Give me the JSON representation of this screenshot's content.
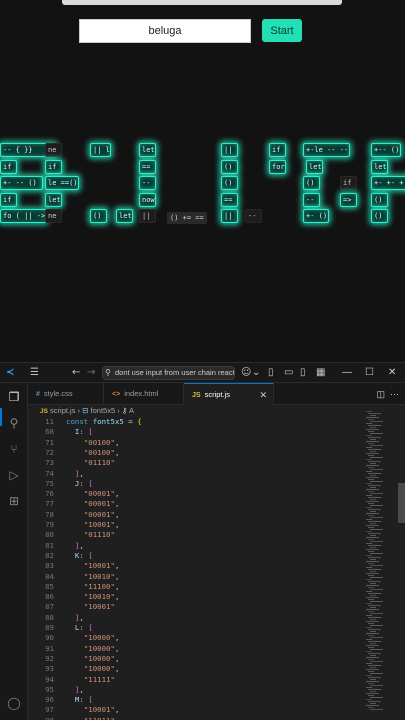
{
  "preview": {
    "input_value": "beluga",
    "start_label": "Start",
    "tiles": [
      {
        "text": "-- {  }}",
        "on": true,
        "row": 0,
        "col": 0,
        "w": 12
      },
      {
        "text": "ne",
        "on": false,
        "row": 0,
        "col": 0.66,
        "w": 3
      },
      {
        "text": "|| le",
        "on": true,
        "row": 0,
        "col": 1.33,
        "w": 4
      },
      {
        "text": "let",
        "on": true,
        "row": 0,
        "col": 2.05,
        "w": 3
      },
      {
        "text": "||",
        "on": true,
        "row": 0,
        "col": 3.25,
        "w": 3
      },
      {
        "text": "if",
        "on": true,
        "row": 0,
        "col": 3.95,
        "w": 3
      },
      {
        "text": "+-le -- --",
        "on": true,
        "row": 0,
        "col": 4.46,
        "w": 10
      },
      {
        "text": "+-- ()",
        "on": true,
        "row": 0,
        "col": 5.45,
        "w": 6
      },
      {
        "text": "if",
        "on": true,
        "row": 1,
        "col": 0,
        "w": 3
      },
      {
        "text": "if",
        "on": true,
        "row": 1,
        "col": 0.66,
        "w": 3
      },
      {
        "text": "==",
        "on": true,
        "row": 1,
        "col": 2.05,
        "w": 3
      },
      {
        "text": "()",
        "on": true,
        "row": 1,
        "col": 3.25,
        "w": 3
      },
      {
        "text": "for",
        "on": true,
        "row": 1,
        "col": 3.95,
        "w": 3
      },
      {
        "text": "let",
        "on": true,
        "row": 1,
        "col": 4.5,
        "w": 3
      },
      {
        "text": "let",
        "on": true,
        "row": 1,
        "col": 5.45,
        "w": 3
      },
      {
        "text": "+-  -- ()",
        "on": true,
        "row": 2,
        "col": 0,
        "w": 9
      },
      {
        "text": "le ==()",
        "on": true,
        "row": 2,
        "col": 0.66,
        "w": 7
      },
      {
        "text": "--",
        "on": true,
        "row": 2,
        "col": 2.05,
        "w": 3
      },
      {
        "text": "()",
        "on": true,
        "row": 2,
        "col": 3.25,
        "w": 3
      },
      {
        "text": "()",
        "on": true,
        "row": 2,
        "col": 4.46,
        "w": 3
      },
      {
        "text": "if",
        "on": false,
        "row": 2,
        "col": 5.0,
        "w": 3
      },
      {
        "text": "+- +- + ()",
        "on": true,
        "row": 2,
        "col": 5.45,
        "w": 10
      },
      {
        "text": "if",
        "on": true,
        "row": 3,
        "col": 0,
        "w": 3
      },
      {
        "text": "let",
        "on": true,
        "row": 3,
        "col": 0.66,
        "w": 3
      },
      {
        "text": "now",
        "on": true,
        "row": 3,
        "col": 2.05,
        "w": 3
      },
      {
        "text": "==",
        "on": true,
        "row": 3,
        "col": 3.25,
        "w": 3
      },
      {
        "text": "--",
        "on": true,
        "row": 3,
        "col": 4.46,
        "w": 3
      },
      {
        "text": "=>",
        "on": true,
        "row": 3,
        "col": 5.0,
        "w": 3
      },
      {
        "text": "()",
        "on": true,
        "row": 3,
        "col": 5.45,
        "w": 3
      },
      {
        "text": "fo ( || ->",
        "on": true,
        "row": 4,
        "col": 0,
        "w": 10
      },
      {
        "text": "ne",
        "on": false,
        "row": 4,
        "col": 0.66,
        "w": 3
      },
      {
        "text": "()",
        "on": true,
        "row": 4,
        "col": 1.33,
        "w": 3
      },
      {
        "text": "let",
        "on": true,
        "row": 4,
        "col": 1.7,
        "w": 3
      },
      {
        "text": "||",
        "on": false,
        "row": 4,
        "col": 2.05,
        "w": 3
      },
      {
        "text": "||",
        "on": true,
        "row": 4,
        "col": 3.25,
        "w": 3
      },
      {
        "text": "--",
        "on": false,
        "row": 4,
        "col": 3.6,
        "w": 3
      },
      {
        "text": "+- ()",
        "on": true,
        "row": 4,
        "col": 4.46,
        "w": 5
      },
      {
        "text": "()",
        "on": true,
        "row": 4,
        "col": 5.45,
        "w": 3
      }
    ],
    "floating_token": "() += =="
  },
  "vscode": {
    "command_center": "dont use input from user chain reactio",
    "tabs": [
      {
        "icon": "#",
        "label": "style.css",
        "active": false
      },
      {
        "icon": "<>",
        "label": "index.html",
        "active": false
      },
      {
        "icon": "JS",
        "label": "script.js",
        "active": true
      }
    ],
    "breadcrumb": [
      "script.js",
      "font5x5",
      "A"
    ],
    "sticky": [
      {
        "n": "11",
        "parts": [
          [
            "kw",
            "const "
          ],
          [
            "var",
            "font5x5"
          ],
          [
            "punc",
            " = "
          ],
          [
            "br1",
            "{"
          ]
        ]
      },
      {
        "n": "68",
        "parts": [
          [
            "punc",
            "  "
          ],
          [
            "var",
            "I"
          ],
          [
            "punc",
            ": "
          ],
          [
            "br2",
            "["
          ]
        ]
      }
    ],
    "lines": [
      {
        "n": "71",
        "parts": [
          [
            "punc",
            "    "
          ],
          [
            "str",
            "\"00100\""
          ],
          [
            "punc",
            ","
          ]
        ]
      },
      {
        "n": "72",
        "parts": [
          [
            "punc",
            "    "
          ],
          [
            "str",
            "\"00100\""
          ],
          [
            "punc",
            ","
          ]
        ]
      },
      {
        "n": "73",
        "parts": [
          [
            "punc",
            "    "
          ],
          [
            "str",
            "\"01110\""
          ]
        ]
      },
      {
        "n": "74",
        "parts": [
          [
            "punc",
            "  "
          ],
          [
            "br2",
            "]"
          ],
          [
            "punc",
            ","
          ]
        ]
      },
      {
        "n": "75",
        "parts": [
          [
            "punc",
            "  "
          ],
          [
            "var",
            "J"
          ],
          [
            "punc",
            ": "
          ],
          [
            "br2",
            "["
          ]
        ]
      },
      {
        "n": "76",
        "parts": [
          [
            "punc",
            "    "
          ],
          [
            "str",
            "\"00001\""
          ],
          [
            "punc",
            ","
          ]
        ]
      },
      {
        "n": "77",
        "parts": [
          [
            "punc",
            "    "
          ],
          [
            "str",
            "\"00001\""
          ],
          [
            "punc",
            ","
          ]
        ]
      },
      {
        "n": "78",
        "parts": [
          [
            "punc",
            "    "
          ],
          [
            "str",
            "\"00001\""
          ],
          [
            "punc",
            ","
          ]
        ]
      },
      {
        "n": "79",
        "parts": [
          [
            "punc",
            "    "
          ],
          [
            "str",
            "\"10001\""
          ],
          [
            "punc",
            ","
          ]
        ]
      },
      {
        "n": "80",
        "parts": [
          [
            "punc",
            "    "
          ],
          [
            "str",
            "\"01110\""
          ]
        ]
      },
      {
        "n": "81",
        "parts": [
          [
            "punc",
            "  "
          ],
          [
            "br2",
            "]"
          ],
          [
            "punc",
            ","
          ]
        ]
      },
      {
        "n": "82",
        "parts": [
          [
            "punc",
            "  "
          ],
          [
            "var",
            "K"
          ],
          [
            "punc",
            ": "
          ],
          [
            "br2",
            "["
          ]
        ]
      },
      {
        "n": "83",
        "parts": [
          [
            "punc",
            "    "
          ],
          [
            "str",
            "\"10001\""
          ],
          [
            "punc",
            ","
          ]
        ]
      },
      {
        "n": "84",
        "parts": [
          [
            "punc",
            "    "
          ],
          [
            "str",
            "\"10010\""
          ],
          [
            "punc",
            ","
          ]
        ]
      },
      {
        "n": "85",
        "parts": [
          [
            "punc",
            "    "
          ],
          [
            "str",
            "\"11100\""
          ],
          [
            "punc",
            ","
          ]
        ]
      },
      {
        "n": "86",
        "parts": [
          [
            "punc",
            "    "
          ],
          [
            "str",
            "\"10010\""
          ],
          [
            "punc",
            ","
          ]
        ]
      },
      {
        "n": "87",
        "parts": [
          [
            "punc",
            "    "
          ],
          [
            "str",
            "\"10001\""
          ]
        ]
      },
      {
        "n": "88",
        "parts": [
          [
            "punc",
            "  "
          ],
          [
            "br2",
            "]"
          ],
          [
            "punc",
            ","
          ]
        ]
      },
      {
        "n": "89",
        "parts": [
          [
            "punc",
            "  "
          ],
          [
            "var",
            "L"
          ],
          [
            "punc",
            ": "
          ],
          [
            "br2",
            "["
          ]
        ]
      },
      {
        "n": "90",
        "parts": [
          [
            "punc",
            "    "
          ],
          [
            "str",
            "\"10000\""
          ],
          [
            "punc",
            ","
          ]
        ]
      },
      {
        "n": "91",
        "parts": [
          [
            "punc",
            "    "
          ],
          [
            "str",
            "\"10000\""
          ],
          [
            "punc",
            ","
          ]
        ]
      },
      {
        "n": "92",
        "parts": [
          [
            "punc",
            "    "
          ],
          [
            "str",
            "\"10000\""
          ],
          [
            "punc",
            ","
          ]
        ]
      },
      {
        "n": "93",
        "parts": [
          [
            "punc",
            "    "
          ],
          [
            "str",
            "\"10000\""
          ],
          [
            "punc",
            ","
          ]
        ]
      },
      {
        "n": "94",
        "parts": [
          [
            "punc",
            "    "
          ],
          [
            "str",
            "\"11111\""
          ]
        ]
      },
      {
        "n": "95",
        "parts": [
          [
            "punc",
            "  "
          ],
          [
            "br2",
            "]"
          ],
          [
            "punc",
            ","
          ]
        ]
      },
      {
        "n": "96",
        "parts": [
          [
            "punc",
            "  "
          ],
          [
            "var",
            "M"
          ],
          [
            "punc",
            ": "
          ],
          [
            "br2",
            "["
          ]
        ]
      },
      {
        "n": "97",
        "parts": [
          [
            "punc",
            "    "
          ],
          [
            "str",
            "\"10001\""
          ],
          [
            "punc",
            ","
          ]
        ]
      },
      {
        "n": "98",
        "parts": [
          [
            "punc",
            "    "
          ],
          [
            "str",
            "\"11011\""
          ],
          [
            "punc",
            ","
          ]
        ]
      }
    ],
    "colors": {
      "accent": "#0078d4",
      "glow": "#2ef0c8",
      "start_button": "#22e0b4"
    }
  }
}
